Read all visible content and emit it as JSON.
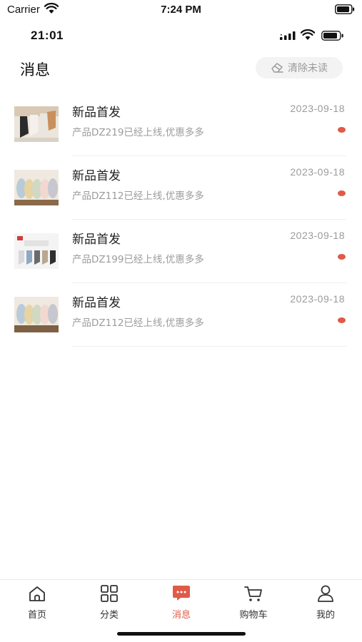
{
  "system_status": {
    "carrier": "Carrier",
    "time": "7:24 PM"
  },
  "app_status": {
    "time": "21:01"
  },
  "header": {
    "title": "消息",
    "clear_label": "清除未读"
  },
  "messages": [
    {
      "title": "新品首发",
      "date": "2023-09-18",
      "desc": "产品DZ219已经上线,优惠多多",
      "unread": true,
      "thumb": "sock-photo-1"
    },
    {
      "title": "新品首发",
      "date": "2023-09-18",
      "desc": "产品DZ112已经上线,优惠多多",
      "unread": true,
      "thumb": "sock-photo-2"
    },
    {
      "title": "新品首发",
      "date": "2023-09-18",
      "desc": "产品DZ199已经上线,优惠多多",
      "unread": true,
      "thumb": "sock-photo-3"
    },
    {
      "title": "新品首发",
      "date": "2023-09-18",
      "desc": "产品DZ112已经上线,优惠多多",
      "unread": true,
      "thumb": "sock-photo-4"
    }
  ],
  "tabbar": {
    "accent_color": "#e05a48",
    "tabs": [
      {
        "label": "首页",
        "icon": "home-icon",
        "active": false
      },
      {
        "label": "分类",
        "icon": "grid-icon",
        "active": false
      },
      {
        "label": "消息",
        "icon": "message-icon",
        "active": true
      },
      {
        "label": "购物车",
        "icon": "cart-icon",
        "active": false
      },
      {
        "label": "我的",
        "icon": "user-icon",
        "active": false
      }
    ]
  }
}
